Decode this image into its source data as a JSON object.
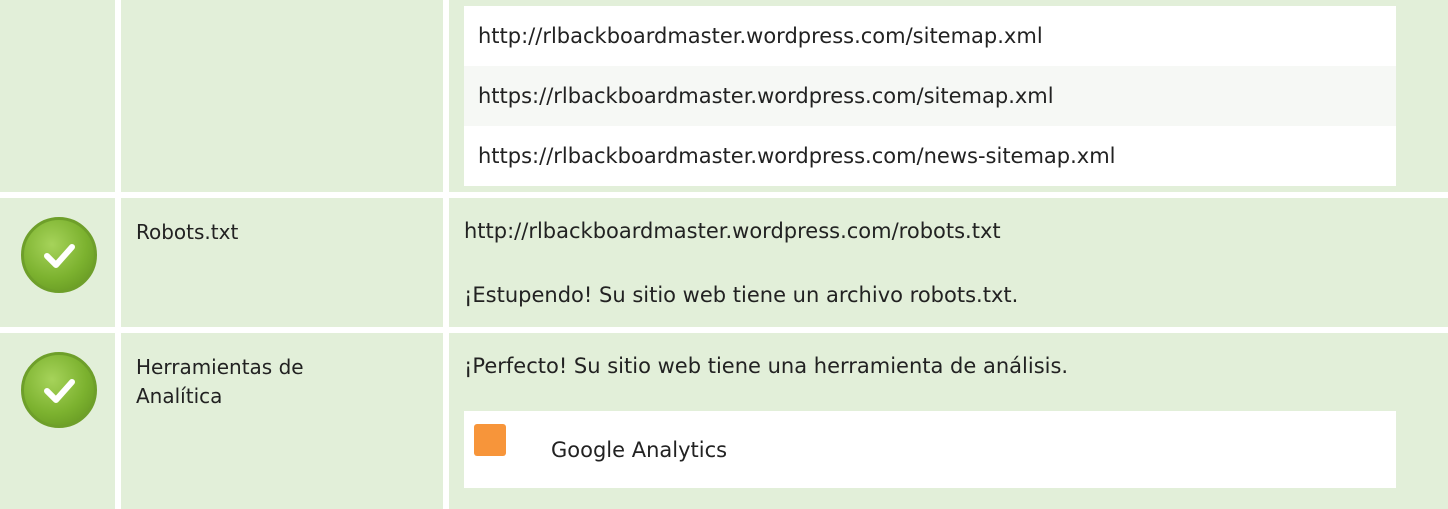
{
  "sitemaps": [
    "http://rlbackboardmaster.wordpress.com/sitemap.xml",
    "https://rlbackboardmaster.wordpress.com/sitemap.xml",
    "https://rlbackboardmaster.wordpress.com/news-sitemap.xml"
  ],
  "robots": {
    "label": "Robots.txt",
    "url": "http://rlbackboardmaster.wordpress.com/robots.txt",
    "message": "¡Estupendo! Su sitio web tiene un archivo robots.txt."
  },
  "analytics": {
    "label_line1": "Herramientas de",
    "label_line2": "Analítica",
    "message": "¡Perfecto! Su sitio web tiene una herramienta de análisis.",
    "tool_name": "Google Analytics",
    "tool_icon": "google-analytics-icon"
  },
  "colors": {
    "row_bg": "#e2efd9",
    "check_green": "#7cb22f",
    "analytics_orange": "#f7953a"
  }
}
